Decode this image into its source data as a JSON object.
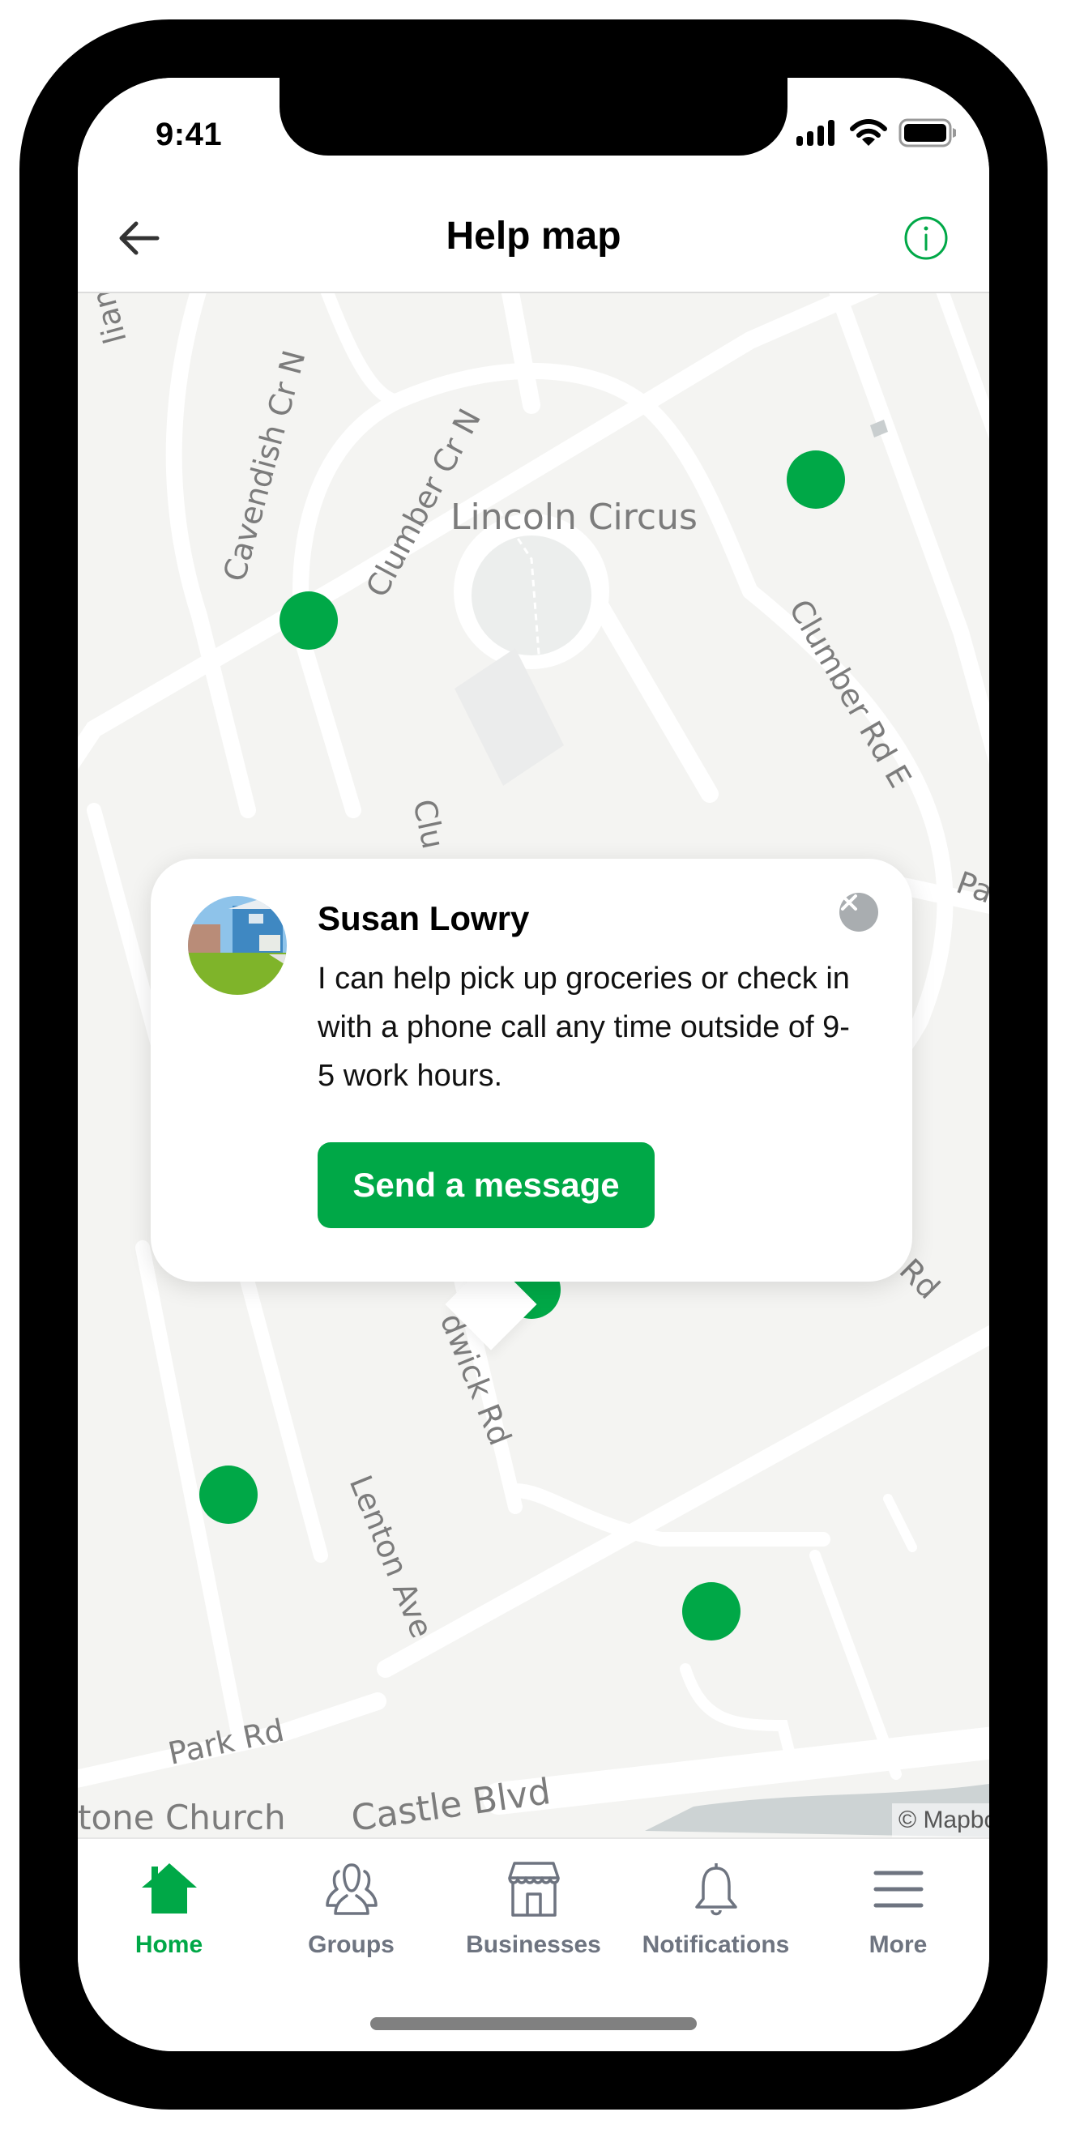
{
  "status_bar": {
    "time": "9:41",
    "icons": [
      "cellular-signal-icon",
      "wifi-icon",
      "battery-icon"
    ]
  },
  "header": {
    "title": "Help map",
    "back_icon": "arrow-left-icon",
    "info_icon": "info-circle-icon"
  },
  "map": {
    "labels": {
      "cavendish": "Cavendish Cr N",
      "clumber_cr": "Clumber Cr N",
      "lincoln": "Lincoln Circus",
      "clumber_rd": "Clumber Rd E",
      "clu": "Clu",
      "pa": "Pa",
      "rd": "Rd",
      "dwick": "dwick Rd",
      "lenton": "Lenton Ave",
      "park": "Park Rd",
      "church": "tone Church",
      "castle": "Castle Blvd",
      "william": "liam C"
    },
    "attribution": "© Mapbox",
    "pins_count": 6,
    "accent_color": "#00a847"
  },
  "card": {
    "name": "Susan Lowry",
    "description": "I can help pick up groceries or check in with a phone call any time outside of 9-5 work hours.",
    "button_label": "Send a message",
    "close_icon": "close-circle-icon"
  },
  "tabbar": {
    "items": [
      {
        "label": "Home",
        "icon": "home-icon",
        "active": true
      },
      {
        "label": "Groups",
        "icon": "groups-icon",
        "active": false
      },
      {
        "label": "Businesses",
        "icon": "storefront-icon",
        "active": false
      },
      {
        "label": "Notifications",
        "icon": "bell-icon",
        "active": false
      },
      {
        "label": "More",
        "icon": "menu-icon",
        "active": false
      }
    ]
  }
}
